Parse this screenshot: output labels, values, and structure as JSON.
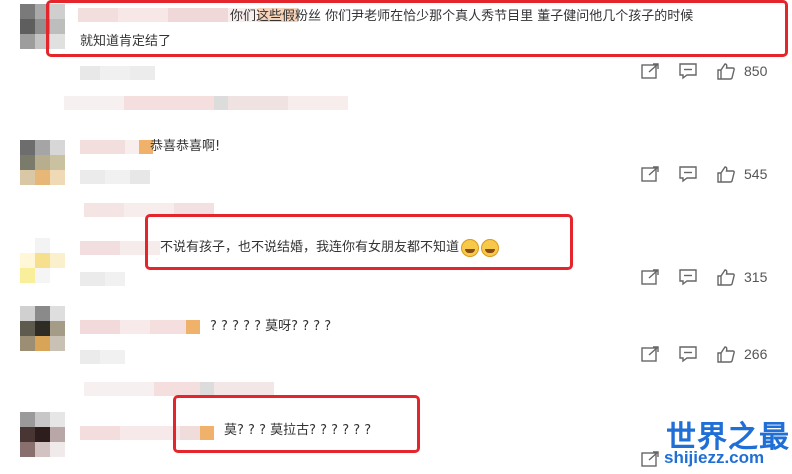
{
  "comments": [
    {
      "text": "你们这些假粉丝 你们尹老师在恰少那个真人秀节目里 董子健问他几个孩子的时候",
      "text2": "就知道肯定结了",
      "likes": "850"
    },
    {
      "text": "恭喜恭喜啊!",
      "likes": "545"
    },
    {
      "text": "不说有孩子，也不说结婚，我连你有女朋友都不知道",
      "likes": "315"
    },
    {
      "text": "? ? ? ? ? 莫呀? ? ? ?",
      "likes": "266"
    },
    {
      "text": "莫? ? ? 莫拉古? ? ? ? ? ?"
    }
  ],
  "watermark": {
    "title": "世界之最",
    "url": "shijiezz.com"
  },
  "colors": {
    "highlight": "#e4252c",
    "watermark": "#1f6fd6"
  },
  "icons": [
    "share-icon",
    "comment-icon",
    "like-icon",
    "laugh-cry-emoji"
  ]
}
